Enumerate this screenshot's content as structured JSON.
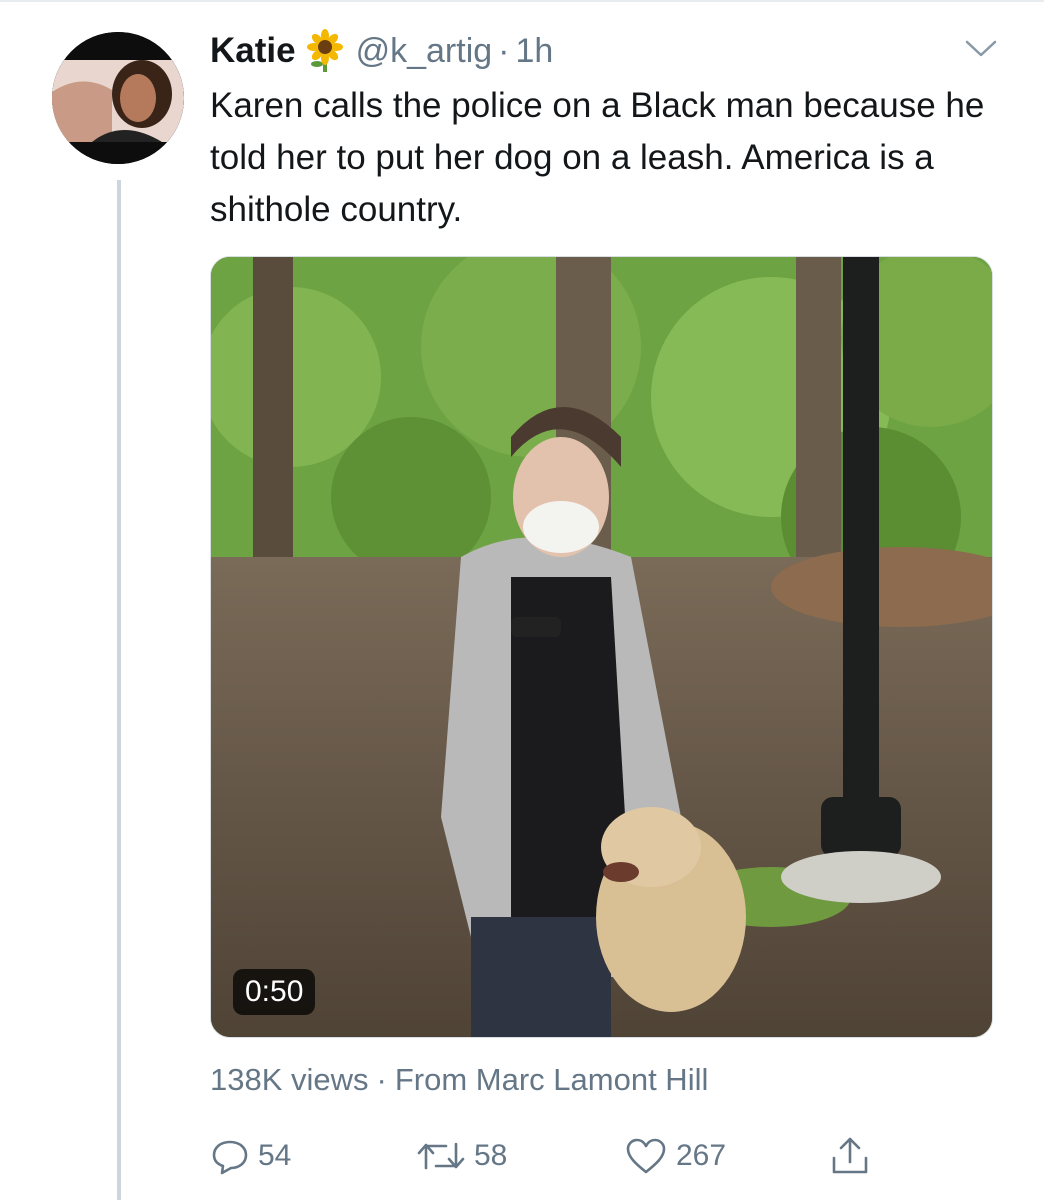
{
  "tweet": {
    "author_name": "Katie",
    "name_emoji": "sunflower-icon",
    "handle": "@k_artig",
    "separator": "·",
    "time": "1h",
    "text": "Karen calls the police on a Black man because he told her to put her dog on a leash. America is a shithole country."
  },
  "media": {
    "type": "video",
    "duration": "0:50"
  },
  "meta": {
    "views": "138K views",
    "separator": "·",
    "source": "From Marc Lamont Hill"
  },
  "actions": {
    "reply_count": "54",
    "retweet_count": "58",
    "like_count": "267"
  },
  "colors": {
    "text": "#14171a",
    "secondary": "#657786",
    "thread_line": "#ccd6dd"
  }
}
